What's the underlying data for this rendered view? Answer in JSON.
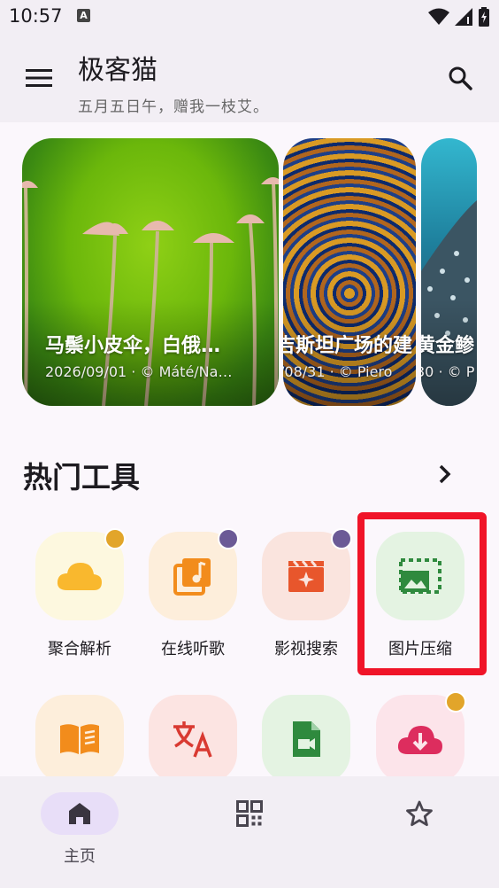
{
  "status_bar": {
    "time": "10:57",
    "notification_icon": "A"
  },
  "app_bar": {
    "title": "极客猫",
    "subtitle": "五月五日午，赠我一枝艾。",
    "menu_icon": "menu-icon",
    "search_icon": "search-icon"
  },
  "carousel": {
    "cards": [
      {
        "title": "马鬃小皮伞，白俄…",
        "meta": "2026/09/01 · © Máté/Na…"
      },
      {
        "title": "吉斯坦广场的建",
        "meta": "/08/31 · © Piero"
      },
      {
        "title": "黄金鲹",
        "meta": "30 · © P"
      }
    ]
  },
  "hot_tools": {
    "title": "热门工具",
    "more_icon": "chevron-right-icon",
    "items": [
      {
        "label": "聚合解析",
        "icon": "cloud-icon",
        "bg": "#fdf8df",
        "color": "#f9b82e",
        "badge": "#e2a52a"
      },
      {
        "label": "在线听歌",
        "icon": "music-library-icon",
        "bg": "#fdeedb",
        "color": "#f28c1c",
        "badge": "#6b5a96"
      },
      {
        "label": "影视搜索",
        "icon": "movie-icon",
        "bg": "#fae4de",
        "color": "#e8562c",
        "badge": "#6b5a96"
      },
      {
        "label": "图片压缩",
        "icon": "image-compress-icon",
        "bg": "#e4f3e2",
        "color": "#2f8a3e",
        "badge": ""
      },
      {
        "label": "",
        "icon": "book-icon",
        "bg": "#fdeedb",
        "color": "#f28c1c",
        "badge": ""
      },
      {
        "label": "",
        "icon": "translate-icon",
        "bg": "#fce4e2",
        "color": "#d93a32",
        "badge": ""
      },
      {
        "label": "",
        "icon": "video-file-icon",
        "bg": "#e4f3e2",
        "color": "#2f8a3e",
        "badge": ""
      },
      {
        "label": "",
        "icon": "cloud-download-icon",
        "bg": "#fce4ea",
        "color": "#dd2d5e",
        "badge": "#e2a52a"
      }
    ]
  },
  "bottom_nav": {
    "items": [
      {
        "label": "主页",
        "icon": "home-icon",
        "active": true
      },
      {
        "label": "",
        "icon": "grid-icon",
        "active": false
      },
      {
        "label": "",
        "icon": "star-icon",
        "active": false
      }
    ]
  }
}
